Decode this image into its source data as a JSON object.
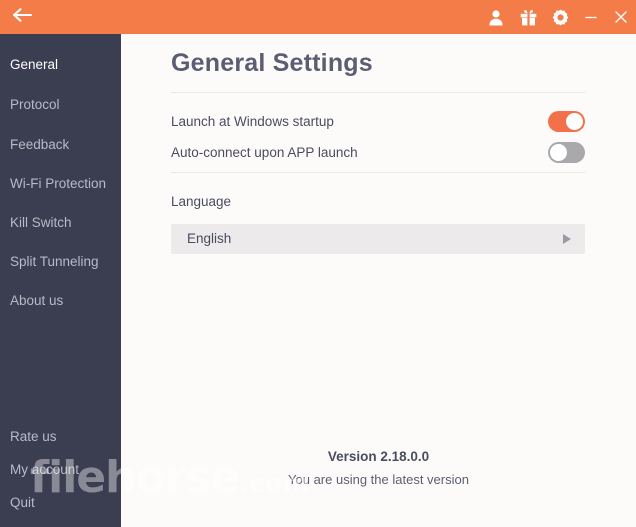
{
  "titlebar": {
    "back_icon": "back-arrow-icon",
    "icons": [
      {
        "name": "account-icon",
        "label": "Account"
      },
      {
        "name": "gift-icon",
        "label": "Gift"
      },
      {
        "name": "gear-icon",
        "label": "Settings"
      }
    ],
    "minimize_label": "–",
    "close_label": "×",
    "background_color": "#f47c48"
  },
  "sidebar": {
    "background_color": "#3b3d51",
    "active_item": "General",
    "items": [
      {
        "label": "General"
      },
      {
        "label": "Protocol"
      },
      {
        "label": "Feedback"
      },
      {
        "label": "Wi-Fi Protection"
      },
      {
        "label": "Kill Switch"
      },
      {
        "label": "Split Tunneling"
      },
      {
        "label": "About us"
      }
    ],
    "bottom_items": [
      {
        "label": "Rate us"
      },
      {
        "label": "My account"
      },
      {
        "label": "Quit"
      }
    ]
  },
  "main": {
    "title": "General Settings",
    "toggles": [
      {
        "label": "Launch at Windows startup",
        "state": "on"
      },
      {
        "label": "Auto-connect upon APP launch",
        "state": "off"
      }
    ],
    "language": {
      "label": "Language",
      "selected": "English"
    }
  },
  "footer": {
    "version": "Version 2.18.0.0",
    "version_note": "You are using the latest version"
  },
  "watermark": {
    "name": "filehorse",
    "suffix": ".com"
  },
  "colors": {
    "accent": "#f47c48",
    "toggle_on": "#f2714a",
    "toggle_off": "#a9a9ac",
    "sidebar": "#3b3d51",
    "content_bg": "#fdfbfa"
  }
}
